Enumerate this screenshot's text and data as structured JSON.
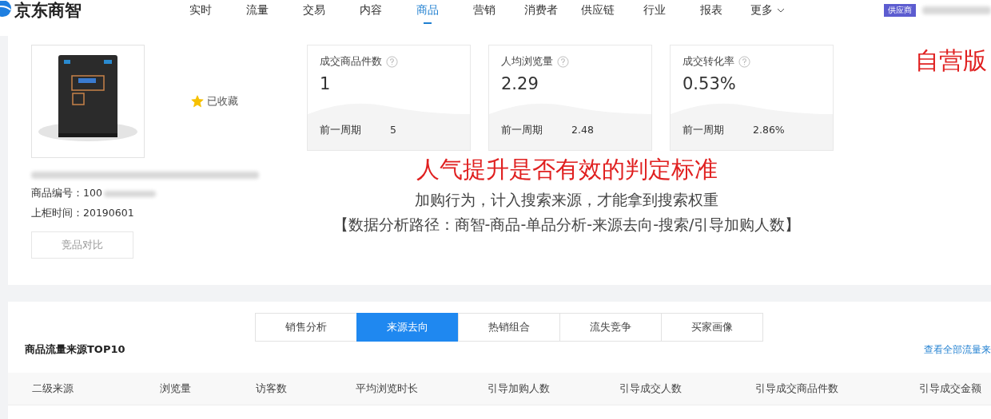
{
  "header": {
    "logo": "京东商智",
    "nav": [
      {
        "label": "实时",
        "selected": false
      },
      {
        "label": "流量",
        "selected": false
      },
      {
        "label": "交易",
        "selected": false
      },
      {
        "label": "内容",
        "selected": false
      },
      {
        "label": "商品",
        "selected": true
      },
      {
        "label": "营销",
        "selected": false
      },
      {
        "label": "消费者",
        "selected": false
      },
      {
        "label": "供应链",
        "selected": false
      },
      {
        "label": "行业",
        "selected": false
      },
      {
        "label": "报表",
        "selected": false
      },
      {
        "label": "更多",
        "selected": false,
        "kind": "dropdown"
      }
    ],
    "role_badge": "供应商"
  },
  "product": {
    "favorite_label": "已收藏",
    "favorited": true,
    "number_label": "商品编号：",
    "number": "100",
    "listed_label": "上柜时间：",
    "listed": "20190601",
    "compare_button": "竞品对比"
  },
  "metrics": [
    {
      "title": "成交商品件数",
      "value": "1",
      "prev_label": "前一周期",
      "prev_value": "5"
    },
    {
      "title": "人均浏览量",
      "value": "2.29",
      "prev_label": "前一周期",
      "prev_value": "2.48"
    },
    {
      "title": "成交转化率",
      "value": "0.53%",
      "prev_label": "前一周期",
      "prev_value": "2.86%"
    }
  ],
  "annotations": {
    "edition_note": "自营版",
    "headline": "人气提升是否有效的判定标准",
    "line_1": "加购行为，计入搜索来源，才能拿到搜索权重",
    "line_2": "【数据分析路径：商智-商品-单品分析-来源去向-搜索/引导加购人数】"
  },
  "tabs": [
    {
      "label": "销售分析",
      "selected": false
    },
    {
      "label": "来源去向",
      "selected": true
    },
    {
      "label": "热销组合",
      "selected": false
    },
    {
      "label": "流失竞争",
      "selected": false
    },
    {
      "label": "买家画像",
      "selected": false
    }
  ],
  "section": {
    "title": "商品流量来源TOP10",
    "link": "查看全部流量来"
  },
  "table": {
    "columns": [
      "二级来源",
      "浏览量",
      "访客数",
      "平均浏览时长",
      "引导加购人数",
      "引导成交人数",
      "引导成交商品件数",
      "引导成交金额"
    ]
  }
}
